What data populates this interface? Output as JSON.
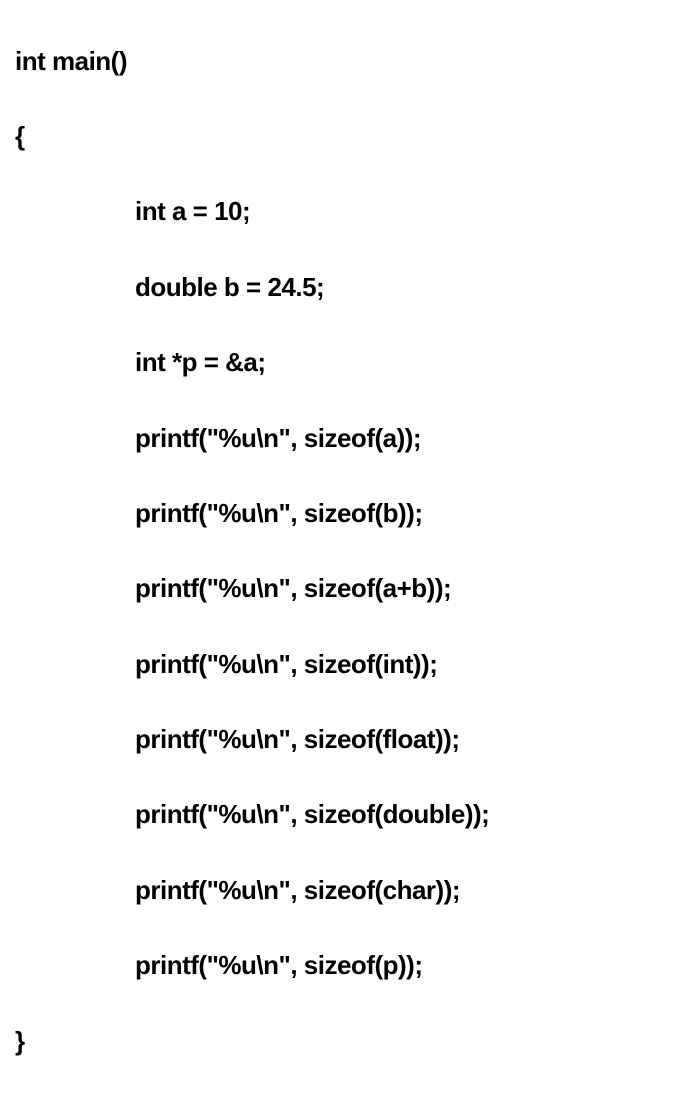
{
  "code": {
    "line1": "int main()",
    "line2": "{",
    "line3": "int a = 10;",
    "line4": "double b = 24.5;",
    "line5": "int *p = &a;",
    "line6": "printf(\"%u\\n\", sizeof(a));",
    "line7": "printf(\"%u\\n\", sizeof(b));",
    "line8": "printf(\"%u\\n\", sizeof(a+b));",
    "line9": "printf(\"%u\\n\", sizeof(int));",
    "line10": "printf(\"%u\\n\", sizeof(float));",
    "line11": "printf(\"%u\\n\", sizeof(double));",
    "line12": "printf(\"%u\\n\", sizeof(char));",
    "line13": "printf(\"%u\\n\", sizeof(p));",
    "line14": "}"
  }
}
